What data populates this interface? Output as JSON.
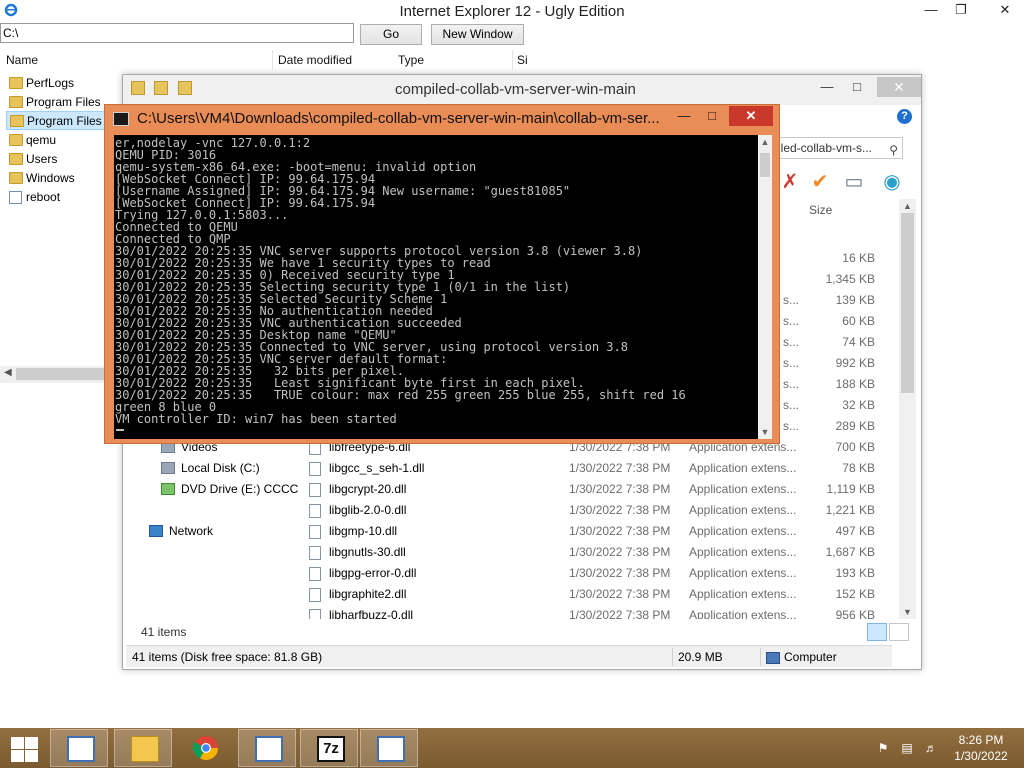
{
  "ie": {
    "title": "Internet Explorer 12 - Ugly Edition",
    "address_value": "C:\\",
    "go_label": "Go",
    "new_window_label": "New Window",
    "columns": {
      "name": "Name",
      "date_modified": "Date modified",
      "type": "Type",
      "size_fragment": "Si"
    },
    "tree": [
      {
        "label": "PerfLogs"
      },
      {
        "label": "Program Files"
      },
      {
        "label": "Program Files ("
      },
      {
        "label": "qemu"
      },
      {
        "label": "Users"
      },
      {
        "label": "Windows"
      },
      {
        "label": "reboot"
      }
    ],
    "status": {
      "items": "41 items (Disk free space: 81.8 GB)",
      "size": "20.9 MB",
      "computer": "Computer"
    }
  },
  "explorer": {
    "title": "compiled-collab-vm-server-win-main",
    "search_value": "iled-collab-vm-s...",
    "size_header": "Size",
    "nav": {
      "videos": "Videos",
      "local_disk": "Local Disk (C:)",
      "dvd_drive": "DVD Drive (E:) CCCC",
      "network": "Network"
    },
    "upper_sizes": [
      "16 KB",
      "1,345 KB",
      "139 KB",
      "60 KB",
      "74 KB",
      "992 KB",
      "188 KB",
      "32 KB",
      "289 KB"
    ],
    "files": [
      {
        "name": "libfreetype-6.dll",
        "date": "1/30/2022 7:38 PM",
        "type": "Application extens...",
        "size": "700 KB"
      },
      {
        "name": "libgcc_s_seh-1.dll",
        "date": "1/30/2022 7:38 PM",
        "type": "Application extens...",
        "size": "78 KB"
      },
      {
        "name": "libgcrypt-20.dll",
        "date": "1/30/2022 7:38 PM",
        "type": "Application extens...",
        "size": "1,119 KB"
      },
      {
        "name": "libglib-2.0-0.dll",
        "date": "1/30/2022 7:38 PM",
        "type": "Application extens...",
        "size": "1,221 KB"
      },
      {
        "name": "libgmp-10.dll",
        "date": "1/30/2022 7:38 PM",
        "type": "Application extens...",
        "size": "497 KB"
      },
      {
        "name": "libgnutls-30.dll",
        "date": "1/30/2022 7:38 PM",
        "type": "Application extens...",
        "size": "1,687 KB"
      },
      {
        "name": "libgpg-error-0.dll",
        "date": "1/30/2022 7:38 PM",
        "type": "Application extens...",
        "size": "193 KB"
      },
      {
        "name": "libgraphite2.dll",
        "date": "1/30/2022 7:38 PM",
        "type": "Application extens...",
        "size": "152 KB"
      },
      {
        "name": "libharfbuzz-0.dll",
        "date": "1/30/2022 7:38 PM",
        "type": "Application extens...",
        "size": "956 KB"
      }
    ],
    "item_count": "41 items"
  },
  "console": {
    "title": "C:\\Users\\VM4\\Downloads\\compiled-collab-vm-server-win-main\\collab-vm-ser...",
    "lines": [
      "er,nodelay -vnc 127.0.0.1:2",
      "QEMU PID: 3016",
      "qemu-system-x86_64.exe: -boot=menu: invalid option",
      "[WebSocket Connect] IP: 99.64.175.94",
      "[Username Assigned] IP: 99.64.175.94 New username: \"guest81085\"",
      "[WebSocket Connect] IP: 99.64.175.94",
      "Trying 127.0.0.1:5803...",
      "Connected to QEMU",
      "Connected to QMP",
      "30/01/2022 20:25:35 VNC server supports protocol version 3.8 (viewer 3.8)",
      "30/01/2022 20:25:35 We have 1 security types to read",
      "30/01/2022 20:25:35 0) Received security type 1",
      "30/01/2022 20:25:35 Selecting security type 1 (0/1 in the list)",
      "30/01/2022 20:25:35 Selected Security Scheme 1",
      "30/01/2022 20:25:35 No authentication needed",
      "30/01/2022 20:25:35 VNC authentication succeeded",
      "30/01/2022 20:25:35 Desktop name \"QEMU\"",
      "30/01/2022 20:25:35 Connected to VNC server, using protocol version 3.8",
      "30/01/2022 20:25:35 VNC server default format:",
      "30/01/2022 20:25:35   32 bits per pixel.",
      "30/01/2022 20:25:35   Least significant byte first in each pixel.",
      "30/01/2022 20:25:35   TRUE colour: max red 255 green 255 blue 255, shift red 16",
      "green 8 blue 0",
      "VM controller ID: win7 has been started"
    ]
  },
  "taskbar": {
    "apps": [
      {
        "icon": "ie-ugly-icon"
      },
      {
        "icon": "file-explorer-icon"
      },
      {
        "icon": "chrome-icon"
      },
      {
        "icon": "ie-ugly-icon"
      },
      {
        "icon": "7zip-icon",
        "label": "7z"
      },
      {
        "icon": "ie-ugly-icon"
      }
    ],
    "time": "8:26 PM",
    "date": "1/30/2022"
  },
  "colors": {
    "console_frame": "#e98c56",
    "console_close": "#c9392b",
    "taskbar": "#8b6a3c"
  }
}
